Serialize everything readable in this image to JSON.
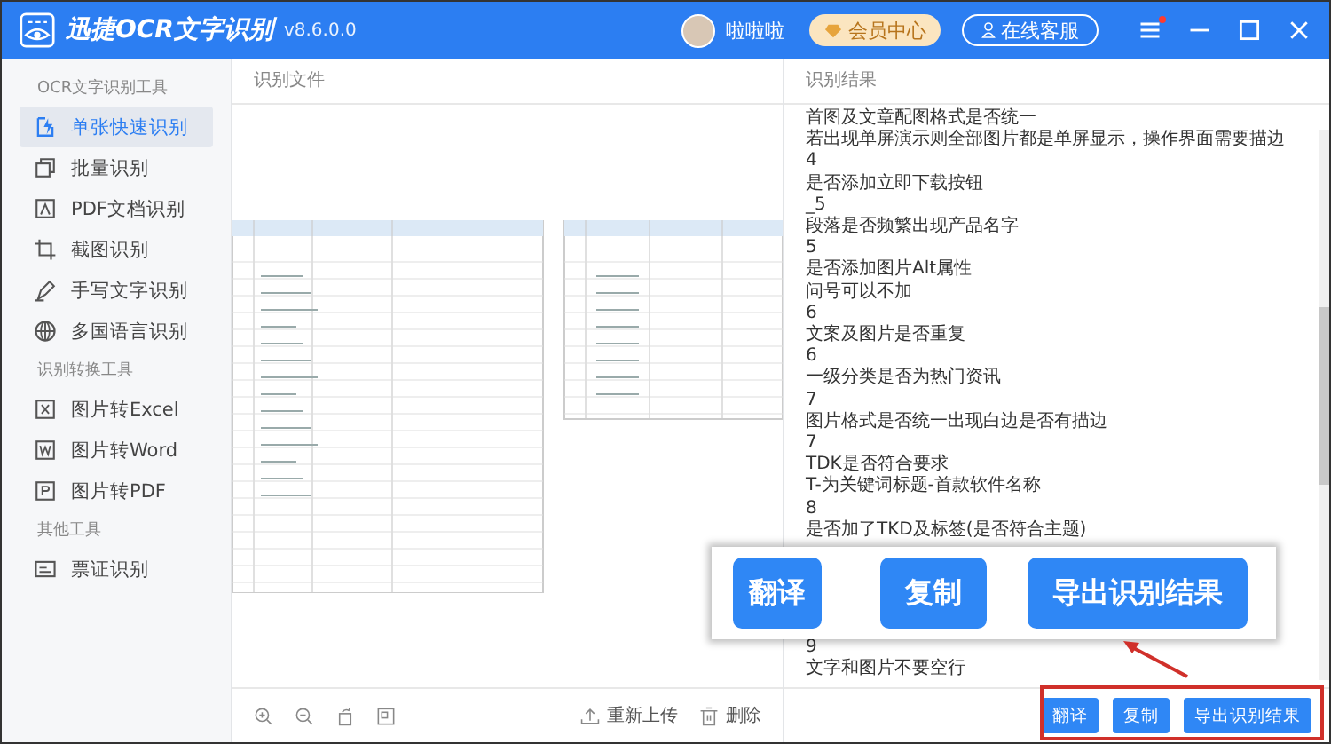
{
  "window": {
    "title": "迅捷OCR文字识别",
    "version": "v8.6.0.0",
    "user": "啦啦啦",
    "vip_button": "会员中心",
    "service_button": "在线客服",
    "menu_badge": true
  },
  "sidebar": {
    "sections": [
      {
        "title": "OCR文字识别工具",
        "items": [
          {
            "label": "单张快速识别",
            "kind": "bolt",
            "selected": true
          },
          {
            "label": "批量识别",
            "kind": "stack",
            "selected": false
          },
          {
            "label": "PDF文档识别",
            "kind": "pdf",
            "selected": false
          },
          {
            "label": "截图识别",
            "kind": "crop",
            "selected": false
          },
          {
            "label": "手写文字识别",
            "kind": "pen",
            "selected": false
          },
          {
            "label": "多国语言识别",
            "kind": "globe",
            "selected": false
          }
        ]
      },
      {
        "title": "识别转换工具",
        "items": [
          {
            "label": "图片转Excel",
            "kind": "x",
            "selected": false
          },
          {
            "label": "图片转Word",
            "kind": "w",
            "selected": false
          },
          {
            "label": "图片转PDF",
            "kind": "p",
            "selected": false
          }
        ]
      },
      {
        "title": "其他工具",
        "items": [
          {
            "label": "票证识别",
            "kind": "card",
            "selected": false
          }
        ]
      }
    ]
  },
  "file_panel": {
    "title": "识别文件",
    "reupload": "重新上传",
    "delete": "删除"
  },
  "result_panel": {
    "title": "识别结果",
    "lines_above": [
      "首图及文章配图格式是否统一",
      "若出现单屏演示则全部图片都是单屏显示，操作界面需要描边",
      "4",
      "是否添加立即下载按钮",
      "_5",
      "段落是否频繁出现产品名字",
      "5",
      "是否添加图片Alt属性",
      "问号可以不加",
      "6",
      "文案及图片是否重复",
      "6",
      "一级分类是否为热门资讯",
      "7",
      "图片格式是否统一出现白边是否有描边",
      "7",
      "TDK是否符合要求",
      "T-为关键词标题-首款软件名称",
      "8",
      "是否加了TKD及标签(是否符合主题)"
    ],
    "lines_below": [
      "9",
      "文字和图片不要空行"
    ],
    "buttons": [
      "翻译",
      "复制",
      "导出识别结果"
    ]
  },
  "callout": {
    "buttons": [
      "翻译",
      "复制",
      "导出识别结果"
    ]
  }
}
